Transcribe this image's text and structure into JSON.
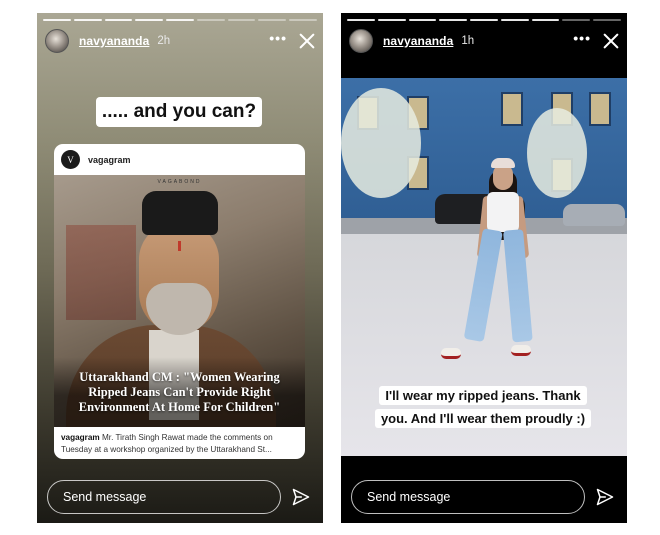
{
  "stories": [
    {
      "username": "navyananda",
      "time": "2h",
      "question": "..... and you can?",
      "post": {
        "account": "vagagram",
        "avatar_letter": "V",
        "brand_mark": "VAGABOND",
        "headline": "Uttarakhand CM : \"Women Wearing Ripped Jeans Can't Provide Right Environment At Home For Children\"",
        "caption_account": "vagagram",
        "caption_text": "Mr. Tirath Singh Rawat made the comments on Tuesday at a workshop organized by the Uttarakhand St..."
      },
      "send_placeholder": "Send message"
    },
    {
      "username": "navyananda",
      "time": "1h",
      "caption": "I'll wear my ripped jeans. Thank you. And I'll wear them proudly :)",
      "send_placeholder": "Send message"
    }
  ]
}
